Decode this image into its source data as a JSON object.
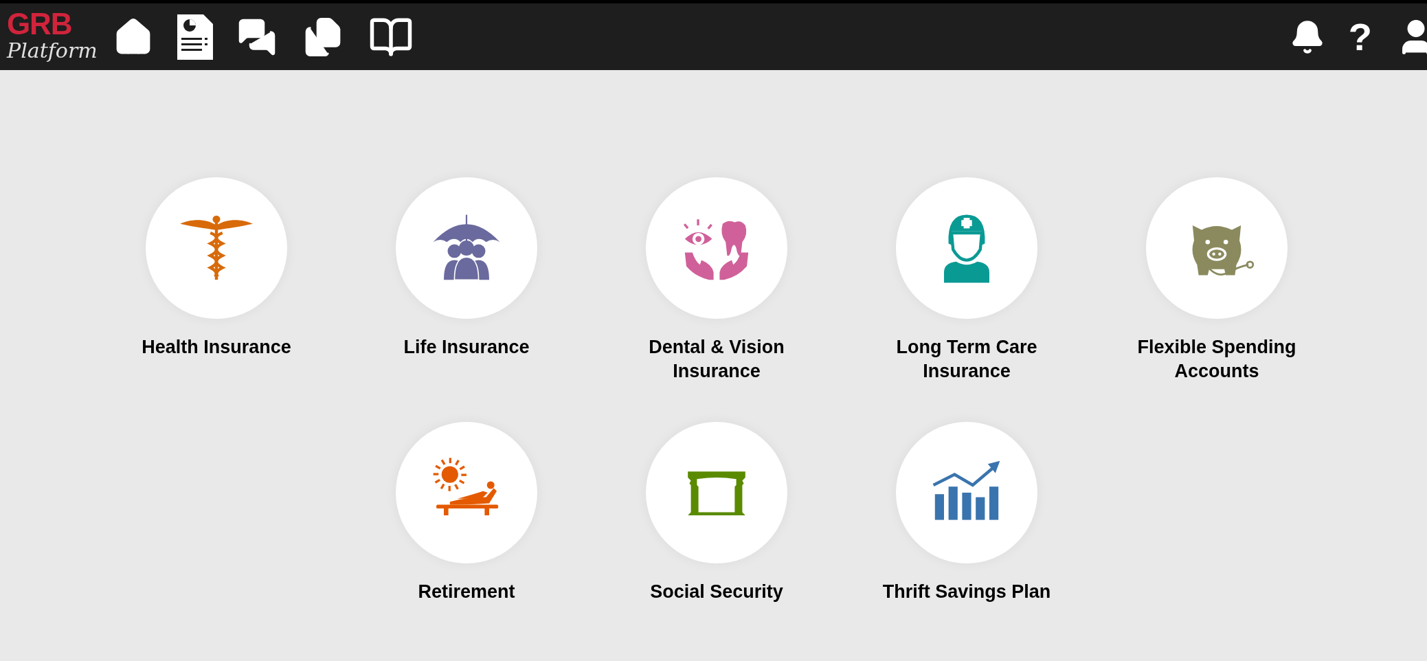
{
  "header": {
    "logo": {
      "brand": "GRB",
      "subtitle": "Platform"
    },
    "help": "?"
  },
  "tiles": [
    {
      "label": "Health Insurance",
      "kind": "caduceus"
    },
    {
      "label": "Life Insurance",
      "kind": "umbrella"
    },
    {
      "label": "Dental & Vision Insurance",
      "kind": "eye-tooth"
    },
    {
      "label": "Long Term Care Insurance",
      "kind": "nurse"
    },
    {
      "label": "Flexible Spending Accounts",
      "kind": "piggy"
    },
    {
      "label": "Retirement",
      "kind": "lounger"
    },
    {
      "label": "Social Security",
      "kind": "arch"
    },
    {
      "label": "Thrift Savings Plan",
      "kind": "chart"
    }
  ]
}
